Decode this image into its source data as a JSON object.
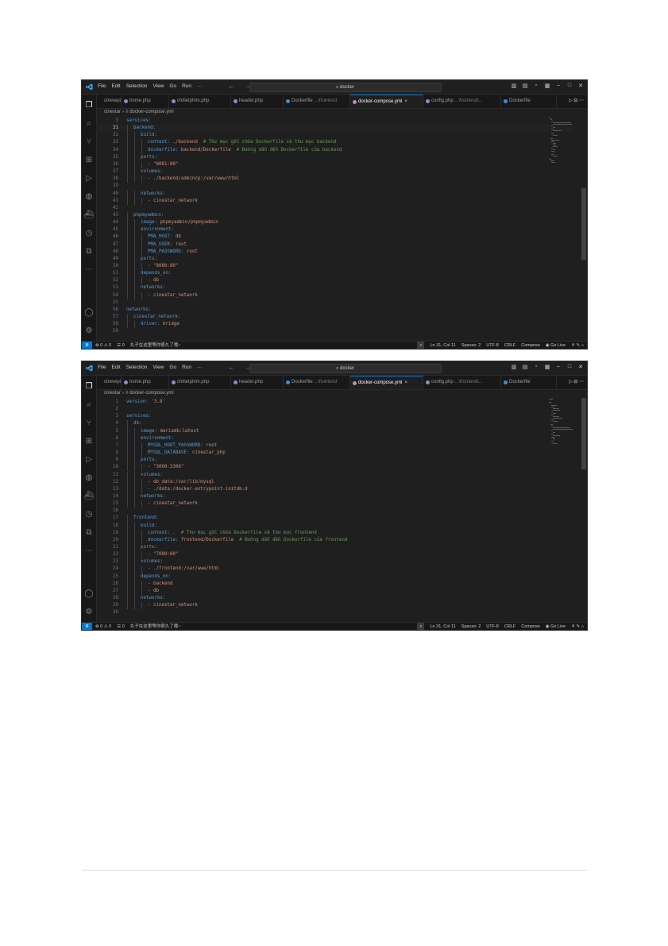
{
  "app": {
    "menus": [
      "File",
      "Edit",
      "Selection",
      "View",
      "Go",
      "Run",
      "···"
    ],
    "search": "docker",
    "nav": "← →",
    "window_controls": [
      "▥",
      "▤",
      "▫",
      "▦",
      "–",
      "□",
      "✕"
    ]
  },
  "colors": {
    "accent": "#0078d4",
    "key": "#569cd6",
    "string": "#ce9178",
    "comment": "#6a9955",
    "php_tab_icon": "#8a8ec9",
    "docker_tab_icon": "#3a8fd6",
    "yml_tab_icon": "#c586c0"
  },
  "activity_icons": [
    "files-icon",
    "search-icon",
    "source-control-icon",
    "extensions-icon",
    "run-debug-icon",
    "edge-icon",
    "docker-icon",
    "timeline-icon",
    "remote-explorer-icon",
    "more-icon",
    "account-icon",
    "settings-gear-icon"
  ],
  "breadcrumb": {
    "folder": "cinestar",
    "sep": "›",
    "file": "docker-compose.yml"
  },
  "status": {
    "remote": "≣",
    "problems": "⊗ 0 ⚠ 0",
    "ports": "☰ 0",
    "extra": "丸子在这里等你很久了哦~",
    "zoom": "⌕",
    "position": "Ln 31, Col 11",
    "spaces": "Spaces: 2",
    "encoding": "UTF-8",
    "eol": "CRLF",
    "language": "Compose",
    "live": "◉ Go Live",
    "icons": "⚘ ✎ ⌂"
  },
  "windows": [
    {
      "tabs": [
        {
          "name": "ctrevepi...",
          "hint": "",
          "icon": "none",
          "active": false
        },
        {
          "name": "home.php",
          "hint": "",
          "icon": "php",
          "active": false
        },
        {
          "name": "chitietphim.php",
          "hint": "",
          "icon": "php",
          "active": false
        },
        {
          "name": "header.php",
          "hint": "",
          "icon": "php",
          "active": false
        },
        {
          "name": "Dockerfile",
          "hint": " ...\\frontend",
          "icon": "docker",
          "active": false
        },
        {
          "name": "docker-compose.yml",
          "hint": "",
          "icon": "yml",
          "active": true
        },
        {
          "name": "config.php",
          "hint": " ...\\frontend\\...",
          "icon": "php",
          "active": false
        },
        {
          "name": "Dockerfile",
          "hint": "",
          "icon": "docker",
          "active": false
        }
      ],
      "current_line": "31",
      "lines": [
        {
          "n": "3",
          "i": 0,
          "k": "services:",
          "v": "",
          "c": ""
        },
        {
          "n": "31",
          "i": 1,
          "k": "backend:",
          "v": "",
          "c": ""
        },
        {
          "n": "32",
          "i": 2,
          "k": "build:",
          "v": "",
          "c": ""
        },
        {
          "n": "33",
          "i": 3,
          "k": "context:",
          "v": " ./backend",
          "c": "  # Thư mục gốc chứa Dockerfile và thư mục backend"
        },
        {
          "n": "34",
          "i": 3,
          "k": "dockerfile:",
          "v": " backend/Dockerfile",
          "c": "  # Đường dẫn đến Dockerfile của backend"
        },
        {
          "n": "35",
          "i": 2,
          "k": "ports:",
          "v": "",
          "c": ""
        },
        {
          "n": "36",
          "i": 3,
          "k": "",
          "v": "- \"8081:80\"",
          "c": ""
        },
        {
          "n": "37",
          "i": 2,
          "k": "volumes:",
          "v": "",
          "c": ""
        },
        {
          "n": "38",
          "i": 3,
          "k": "",
          "v": "- ./backend/admincp:/var/www/html",
          "c": ""
        },
        {
          "n": "39",
          "i": 0,
          "k": "",
          "v": "",
          "c": ""
        },
        {
          "n": "40",
          "i": 2,
          "k": "networks:",
          "v": "",
          "c": ""
        },
        {
          "n": "41",
          "i": 3,
          "k": "",
          "v": "- cinestar_network",
          "c": ""
        },
        {
          "n": "42",
          "i": 0,
          "k": "",
          "v": "",
          "c": ""
        },
        {
          "n": "43",
          "i": 1,
          "k": "phpmyadmin:",
          "v": "",
          "c": ""
        },
        {
          "n": "44",
          "i": 2,
          "k": "image:",
          "v": " phpmyadmin/phpmyadmin",
          "c": ""
        },
        {
          "n": "45",
          "i": 2,
          "k": "environment:",
          "v": "",
          "c": ""
        },
        {
          "n": "46",
          "i": 3,
          "k": "PMA_HOST:",
          "v": " db",
          "c": ""
        },
        {
          "n": "47",
          "i": 3,
          "k": "PMA_USER:",
          "v": " root",
          "c": ""
        },
        {
          "n": "48",
          "i": 3,
          "k": "PMA_PASSWORD:",
          "v": " root",
          "c": ""
        },
        {
          "n": "49",
          "i": 2,
          "k": "ports:",
          "v": "",
          "c": ""
        },
        {
          "n": "50",
          "i": 3,
          "k": "",
          "v": "- \"8080:80\"",
          "c": ""
        },
        {
          "n": "51",
          "i": 2,
          "k": "depends_on:",
          "v": "",
          "c": ""
        },
        {
          "n": "52",
          "i": 3,
          "k": "",
          "v": "- db",
          "c": ""
        },
        {
          "n": "53",
          "i": 2,
          "k": "networks:",
          "v": "",
          "c": ""
        },
        {
          "n": "54",
          "i": 3,
          "k": "",
          "v": "- cinestar_network",
          "c": ""
        },
        {
          "n": "55",
          "i": 0,
          "k": "",
          "v": "",
          "c": ""
        },
        {
          "n": "56",
          "i": 0,
          "k": "networks:",
          "v": "",
          "c": ""
        },
        {
          "n": "57",
          "i": 1,
          "k": "cinestar_network:",
          "v": "",
          "c": ""
        },
        {
          "n": "58",
          "i": 2,
          "k": "driver:",
          "v": " bridge",
          "c": ""
        },
        {
          "n": "59",
          "i": 0,
          "k": "",
          "v": "",
          "c": ""
        }
      ]
    },
    {
      "tabs": [
        {
          "name": "ctrevepi...",
          "hint": "",
          "icon": "none",
          "active": false
        },
        {
          "name": "home.php",
          "hint": "",
          "icon": "php",
          "active": false
        },
        {
          "name": "chitietphim.php",
          "hint": "",
          "icon": "php",
          "active": false
        },
        {
          "name": "header.php",
          "hint": "",
          "icon": "php",
          "active": false
        },
        {
          "name": "Dockerfile",
          "hint": " ...\\frontend",
          "icon": "docker",
          "active": false
        },
        {
          "name": "docker-compose.yml",
          "hint": "",
          "icon": "yml",
          "active": true
        },
        {
          "name": "config.php",
          "hint": " ...\\frontend\\...",
          "icon": "php",
          "active": false
        },
        {
          "name": "Dockerfile",
          "hint": "",
          "icon": "docker",
          "active": false
        }
      ],
      "current_line": "",
      "lines": [
        {
          "n": "1",
          "i": 0,
          "k": "version:",
          "v": " '3.8'",
          "c": ""
        },
        {
          "n": "2",
          "i": 0,
          "k": "",
          "v": "",
          "c": ""
        },
        {
          "n": "3",
          "i": 0,
          "k": "services:",
          "v": "",
          "c": ""
        },
        {
          "n": "4",
          "i": 1,
          "k": "db:",
          "v": "",
          "c": ""
        },
        {
          "n": "5",
          "i": 2,
          "k": "image:",
          "v": " mariadb:latest",
          "c": ""
        },
        {
          "n": "6",
          "i": 2,
          "k": "environment:",
          "v": "",
          "c": ""
        },
        {
          "n": "7",
          "i": 3,
          "k": "MYSQL_ROOT_PASSWORD:",
          "v": " root",
          "c": ""
        },
        {
          "n": "8",
          "i": 3,
          "k": "MYSQL_DATABASE:",
          "v": " cinestar_php",
          "c": ""
        },
        {
          "n": "9",
          "i": 2,
          "k": "ports:",
          "v": "",
          "c": ""
        },
        {
          "n": "10",
          "i": 3,
          "k": "",
          "v": "- \"3000:3306\"",
          "c": ""
        },
        {
          "n": "11",
          "i": 2,
          "k": "volumes:",
          "v": "",
          "c": ""
        },
        {
          "n": "12",
          "i": 3,
          "k": "",
          "v": "- db_data:/var/lib/mysql",
          "c": ""
        },
        {
          "n": "13",
          "i": 3,
          "k": "",
          "v": "- ./data:/docker-entrypoint-initdb.d",
          "c": ""
        },
        {
          "n": "14",
          "i": 2,
          "k": "networks:",
          "v": "",
          "c": ""
        },
        {
          "n": "15",
          "i": 3,
          "k": "",
          "v": "- cinestar_network",
          "c": ""
        },
        {
          "n": "16",
          "i": 0,
          "k": "",
          "v": "",
          "c": ""
        },
        {
          "n": "17",
          "i": 1,
          "k": "frontend:",
          "v": "",
          "c": ""
        },
        {
          "n": "18",
          "i": 2,
          "k": "build:",
          "v": "",
          "c": ""
        },
        {
          "n": "19",
          "i": 3,
          "k": "context:",
          "v": " .",
          "c": "  # Thư mục gốc chứa Dockerfile và thư mục frontend"
        },
        {
          "n": "20",
          "i": 3,
          "k": "dockerfile:",
          "v": " frontend/Dockerfile",
          "c": "  # Đường dẫn đến Dockerfile của frontend"
        },
        {
          "n": "21",
          "i": 2,
          "k": "ports:",
          "v": "",
          "c": ""
        },
        {
          "n": "22",
          "i": 3,
          "k": "",
          "v": "- \"7080:80\"",
          "c": ""
        },
        {
          "n": "23",
          "i": 2,
          "k": "volumes:",
          "v": "",
          "c": ""
        },
        {
          "n": "24",
          "i": 3,
          "k": "",
          "v": "- ./frontend:/var/www/html",
          "c": ""
        },
        {
          "n": "25",
          "i": 2,
          "k": "depends_on:",
          "v": "",
          "c": ""
        },
        {
          "n": "26",
          "i": 3,
          "k": "",
          "v": "- backend",
          "c": ""
        },
        {
          "n": "27",
          "i": 3,
          "k": "",
          "v": "- db",
          "c": ""
        },
        {
          "n": "28",
          "i": 2,
          "k": "networks:",
          "v": "",
          "c": ""
        },
        {
          "n": "29",
          "i": 3,
          "k": "",
          "v": "- cinestar_network",
          "c": ""
        },
        {
          "n": "30",
          "i": 0,
          "k": "",
          "v": "",
          "c": ""
        }
      ]
    }
  ]
}
